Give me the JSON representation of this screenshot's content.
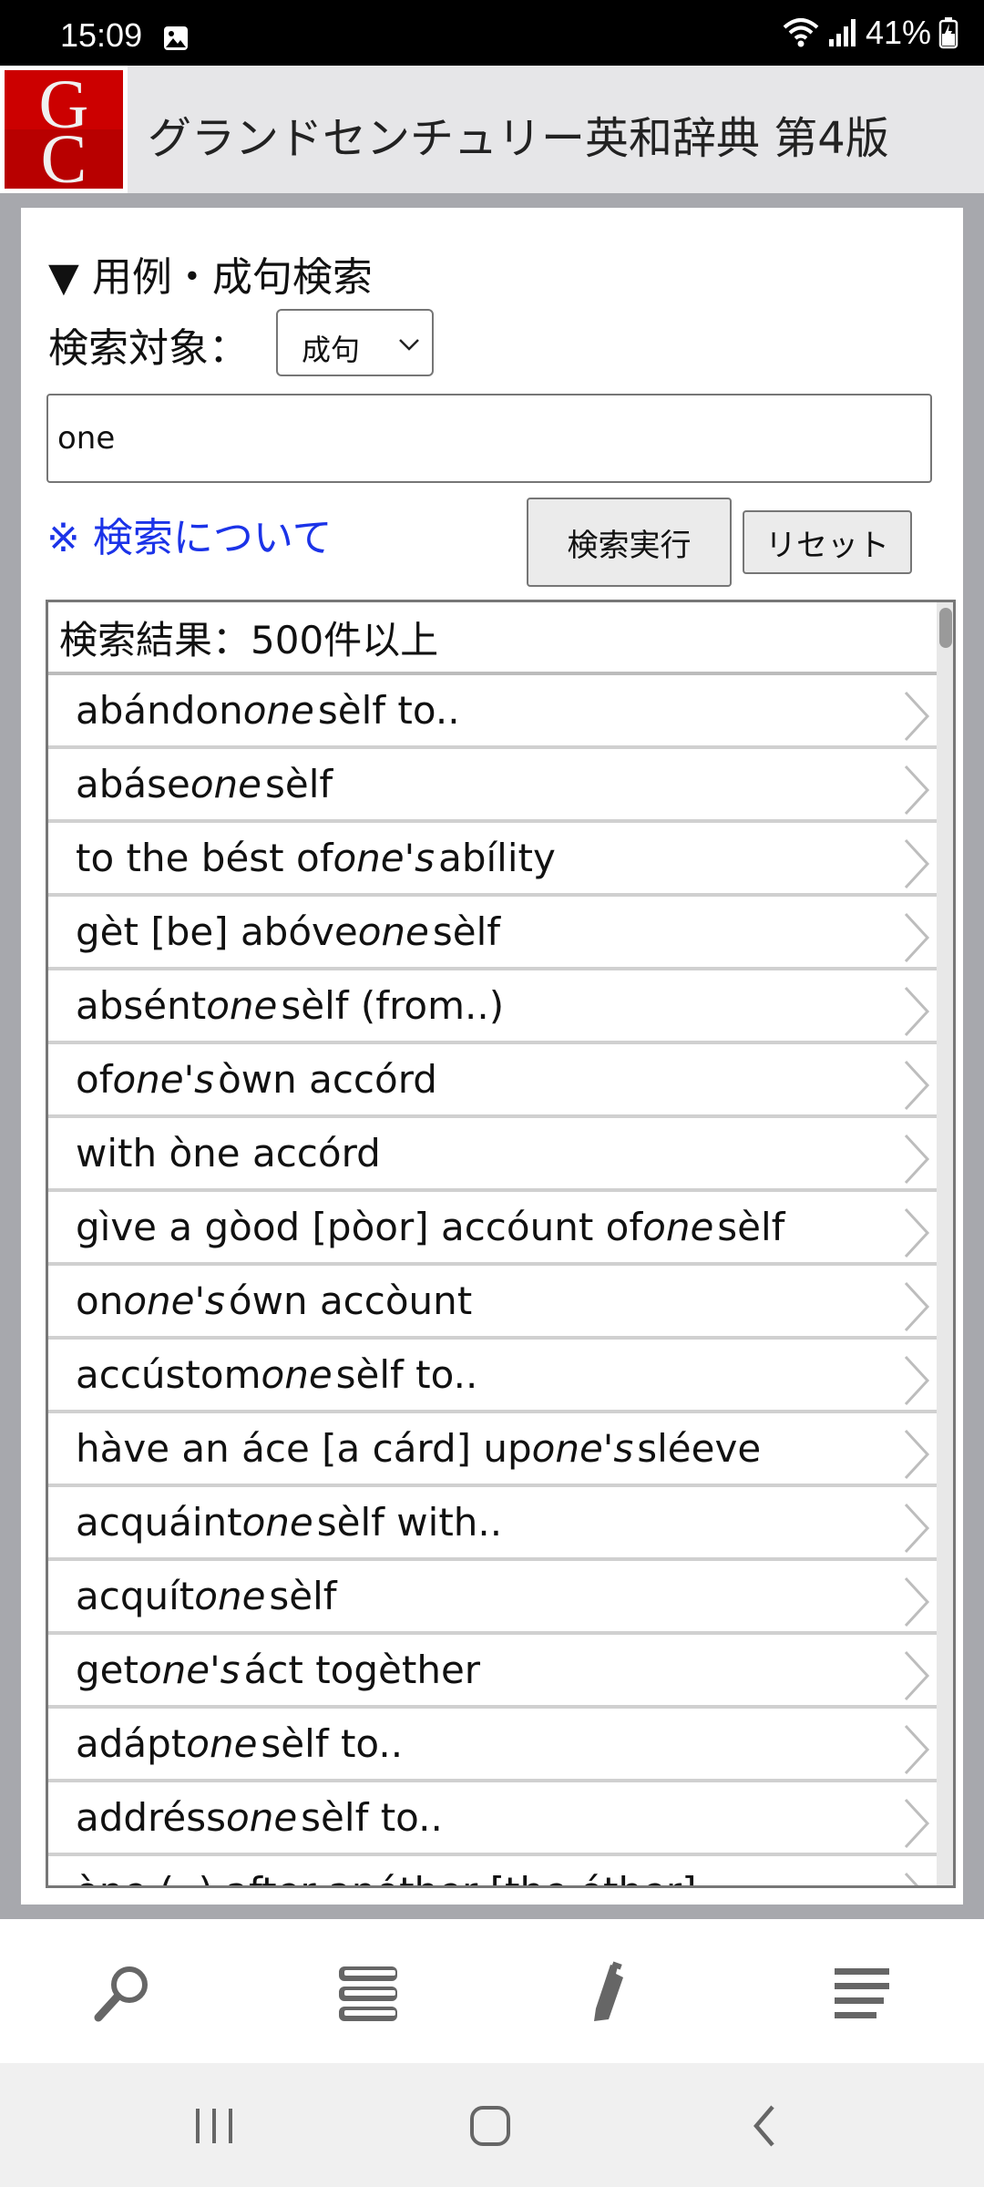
{
  "status": {
    "time": "15:09",
    "battery": "41%"
  },
  "header": {
    "logo_text_top": "G",
    "logo_text_bottom": "C",
    "title": "グランドセンチュリー英和辞典 第4版"
  },
  "search": {
    "section_title": "▼ 用例・成句検索",
    "target_label": "検索対象：",
    "target_value": "成句",
    "query_value": "one",
    "about_link": "※ 検索について",
    "execute_label": "検索実行",
    "reset_label": "リセット"
  },
  "results": {
    "header": "検索結果：500件以上",
    "items": [
      [
        [
          "abándon ",
          false
        ],
        [
          "one",
          true
        ],
        [
          "sèlf to..",
          false
        ]
      ],
      [
        [
          "abáse ",
          false
        ],
        [
          "one",
          true
        ],
        [
          "sèlf",
          false
        ]
      ],
      [
        [
          "to the bést of ",
          false
        ],
        [
          "one's",
          true
        ],
        [
          " abílity",
          false
        ]
      ],
      [
        [
          "gèt [be] abóve ",
          false
        ],
        [
          "one",
          true
        ],
        [
          "sèlf",
          false
        ]
      ],
      [
        [
          "absént ",
          false
        ],
        [
          "one",
          true
        ],
        [
          "sèlf (from..)",
          false
        ]
      ],
      [
        [
          "of ",
          false
        ],
        [
          "one's",
          true
        ],
        [
          " òwn accórd",
          false
        ]
      ],
      [
        [
          "with òne accórd",
          false
        ]
      ],
      [
        [
          "gìve a gòod [pòor] accóunt of ",
          false
        ],
        [
          "one",
          true
        ],
        [
          "sèlf",
          false
        ]
      ],
      [
        [
          "on ",
          false
        ],
        [
          "one's",
          true
        ],
        [
          " ówn accòunt",
          false
        ]
      ],
      [
        [
          "accústom ",
          false
        ],
        [
          "one",
          true
        ],
        [
          "sèlf to..",
          false
        ]
      ],
      [
        [
          "hàve an áce [a cárd] up ",
          false
        ],
        [
          "one's",
          true
        ],
        [
          " sléeve",
          false
        ]
      ],
      [
        [
          "acquáint ",
          false
        ],
        [
          "one",
          true
        ],
        [
          "sèlf with..",
          false
        ]
      ],
      [
        [
          "acquít ",
          false
        ],
        [
          "one",
          true
        ],
        [
          "sèlf",
          false
        ]
      ],
      [
        [
          "get ",
          false
        ],
        [
          "one's",
          true
        ],
        [
          " áct togèther",
          false
        ]
      ],
      [
        [
          "adápt ",
          false
        ],
        [
          "one",
          true
        ],
        [
          "sèlf to..",
          false
        ]
      ],
      [
        [
          "addréss ",
          false
        ],
        [
          "one",
          true
        ],
        [
          "sèlf to..",
          false
        ]
      ],
      [
        [
          "òne (..) after anóther [the óther]",
          false
        ]
      ]
    ]
  },
  "nav": {
    "items": [
      "search-icon",
      "books-icon",
      "marker-icon",
      "menu-icon"
    ]
  },
  "colors": {
    "link": "#1b33e8",
    "logo_red": "#cc0000",
    "header_bg": "#e6e6e8",
    "frame_bg": "#a7a8ad"
  }
}
